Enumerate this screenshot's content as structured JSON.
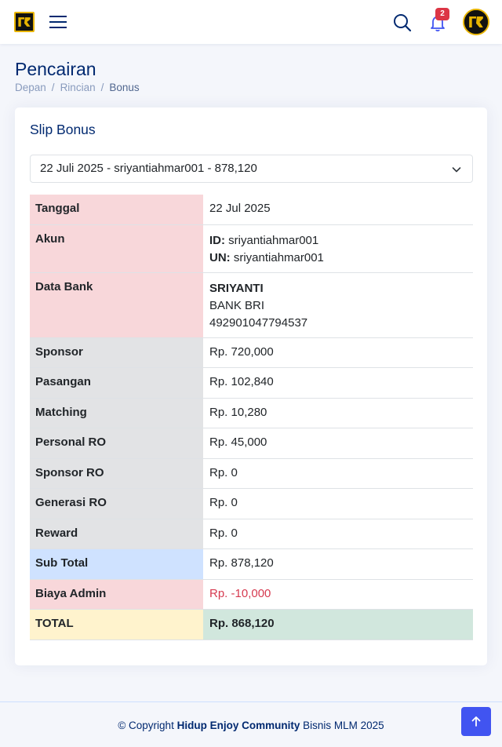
{
  "header": {
    "logo_icon": "brand-logo-icon",
    "menu_icon": "hamburger-icon",
    "search_icon": "search-icon",
    "notification_icon": "bell-icon",
    "notification_count": "2",
    "avatar_icon": "avatar-icon"
  },
  "page": {
    "title": "Pencairan",
    "breadcrumb": [
      "Depan",
      "Rincian",
      "Bonus"
    ]
  },
  "card": {
    "title": "Slip Bonus",
    "select_value": "22 Juli 2025 - sriyantiahmar001 - 878,120",
    "rows": {
      "tanggal": {
        "label": "Tanggal",
        "value": "22 Jul 2025"
      },
      "akun": {
        "label": "Akun",
        "id_label": "ID:",
        "id_value": "sriyantiahmar001",
        "un_label": "UN:",
        "un_value": "sriyantiahmar001"
      },
      "bank": {
        "label": "Data Bank",
        "name": "SRIYANTI",
        "bank_name": "BANK BRI",
        "account": "492901047794537"
      },
      "sponsor": {
        "label": "Sponsor",
        "value": "Rp. 720,000"
      },
      "pasangan": {
        "label": "Pasangan",
        "value": "Rp. 102,840"
      },
      "matching": {
        "label": "Matching",
        "value": "Rp. 10,280"
      },
      "personal_ro": {
        "label": "Personal RO",
        "value": "Rp. 45,000"
      },
      "sponsor_ro": {
        "label": "Sponsor RO",
        "value": "Rp. 0"
      },
      "generasi_ro": {
        "label": "Generasi RO",
        "value": "Rp. 0"
      },
      "reward": {
        "label": "Reward",
        "value": "Rp. 0"
      },
      "sub_total": {
        "label": "Sub Total",
        "value": "Rp. 878,120"
      },
      "biaya_admin": {
        "label": "Biaya Admin",
        "value": "Rp. -10,000"
      },
      "total": {
        "label": "TOTAL",
        "value": "Rp. 868,120"
      }
    }
  },
  "footer": {
    "prefix": "© Copyright",
    "brand": "Hidup Enjoy Community",
    "suffix": "Bisnis MLM 2025",
    "back_to_top_icon": "arrow-up-icon"
  },
  "colors": {
    "accent": "#4154f1",
    "title": "#012970",
    "danger_cell": "#f8d7da",
    "secondary_cell": "#e2e3e5",
    "primary_cell": "#cfe2ff",
    "warning_cell": "#fff3cd",
    "success_cell": "#d1e7dd",
    "negative_text": "#d63a50"
  }
}
